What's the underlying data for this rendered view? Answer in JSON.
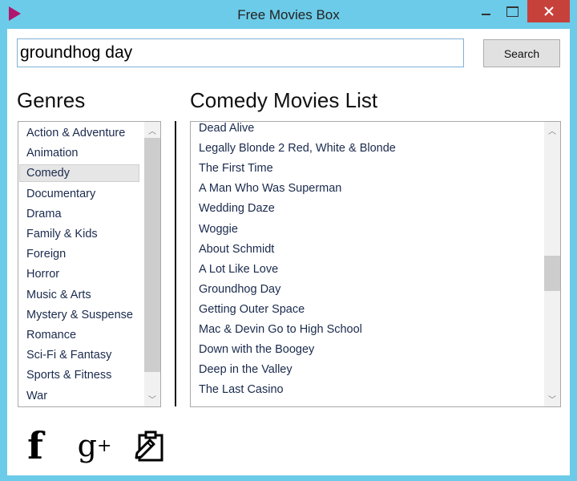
{
  "window": {
    "title": "Free Movies Box",
    "app_icon": "play-triangle-icon",
    "accent_color": "#6ccbe8",
    "close_color": "#c7413b"
  },
  "search": {
    "value": "groundhog day",
    "button_label": "Search"
  },
  "genres": {
    "heading": "Genres",
    "selected": "Comedy",
    "items": [
      "Action & Adventure",
      "Animation",
      "Comedy",
      "Documentary",
      "Drama",
      "Family & Kids",
      "Foreign",
      "Horror",
      "Music & Arts",
      "Mystery & Suspense",
      "Romance",
      "Sci-Fi & Fantasy",
      "Sports & Fitness",
      "War"
    ]
  },
  "movies": {
    "heading": "Comedy Movies List",
    "items": [
      "Dead Alive",
      "Legally Blonde 2 Red, White & Blonde",
      "The First Time",
      "A Man Who Was Superman",
      "Wedding Daze",
      "Woggie",
      "About Schmidt",
      "A Lot Like Love",
      "Groundhog Day",
      "Getting Outer Space",
      "Mac & Devin Go to High School",
      "Down with the Boogey",
      "Deep in the Valley",
      "The Last Casino"
    ]
  },
  "social": {
    "facebook_glyph": "f",
    "gplus_glyph": "g",
    "gplus_sup": "+",
    "icons": [
      "facebook-icon",
      "google-plus-icon",
      "clipboard-edit-icon"
    ]
  }
}
